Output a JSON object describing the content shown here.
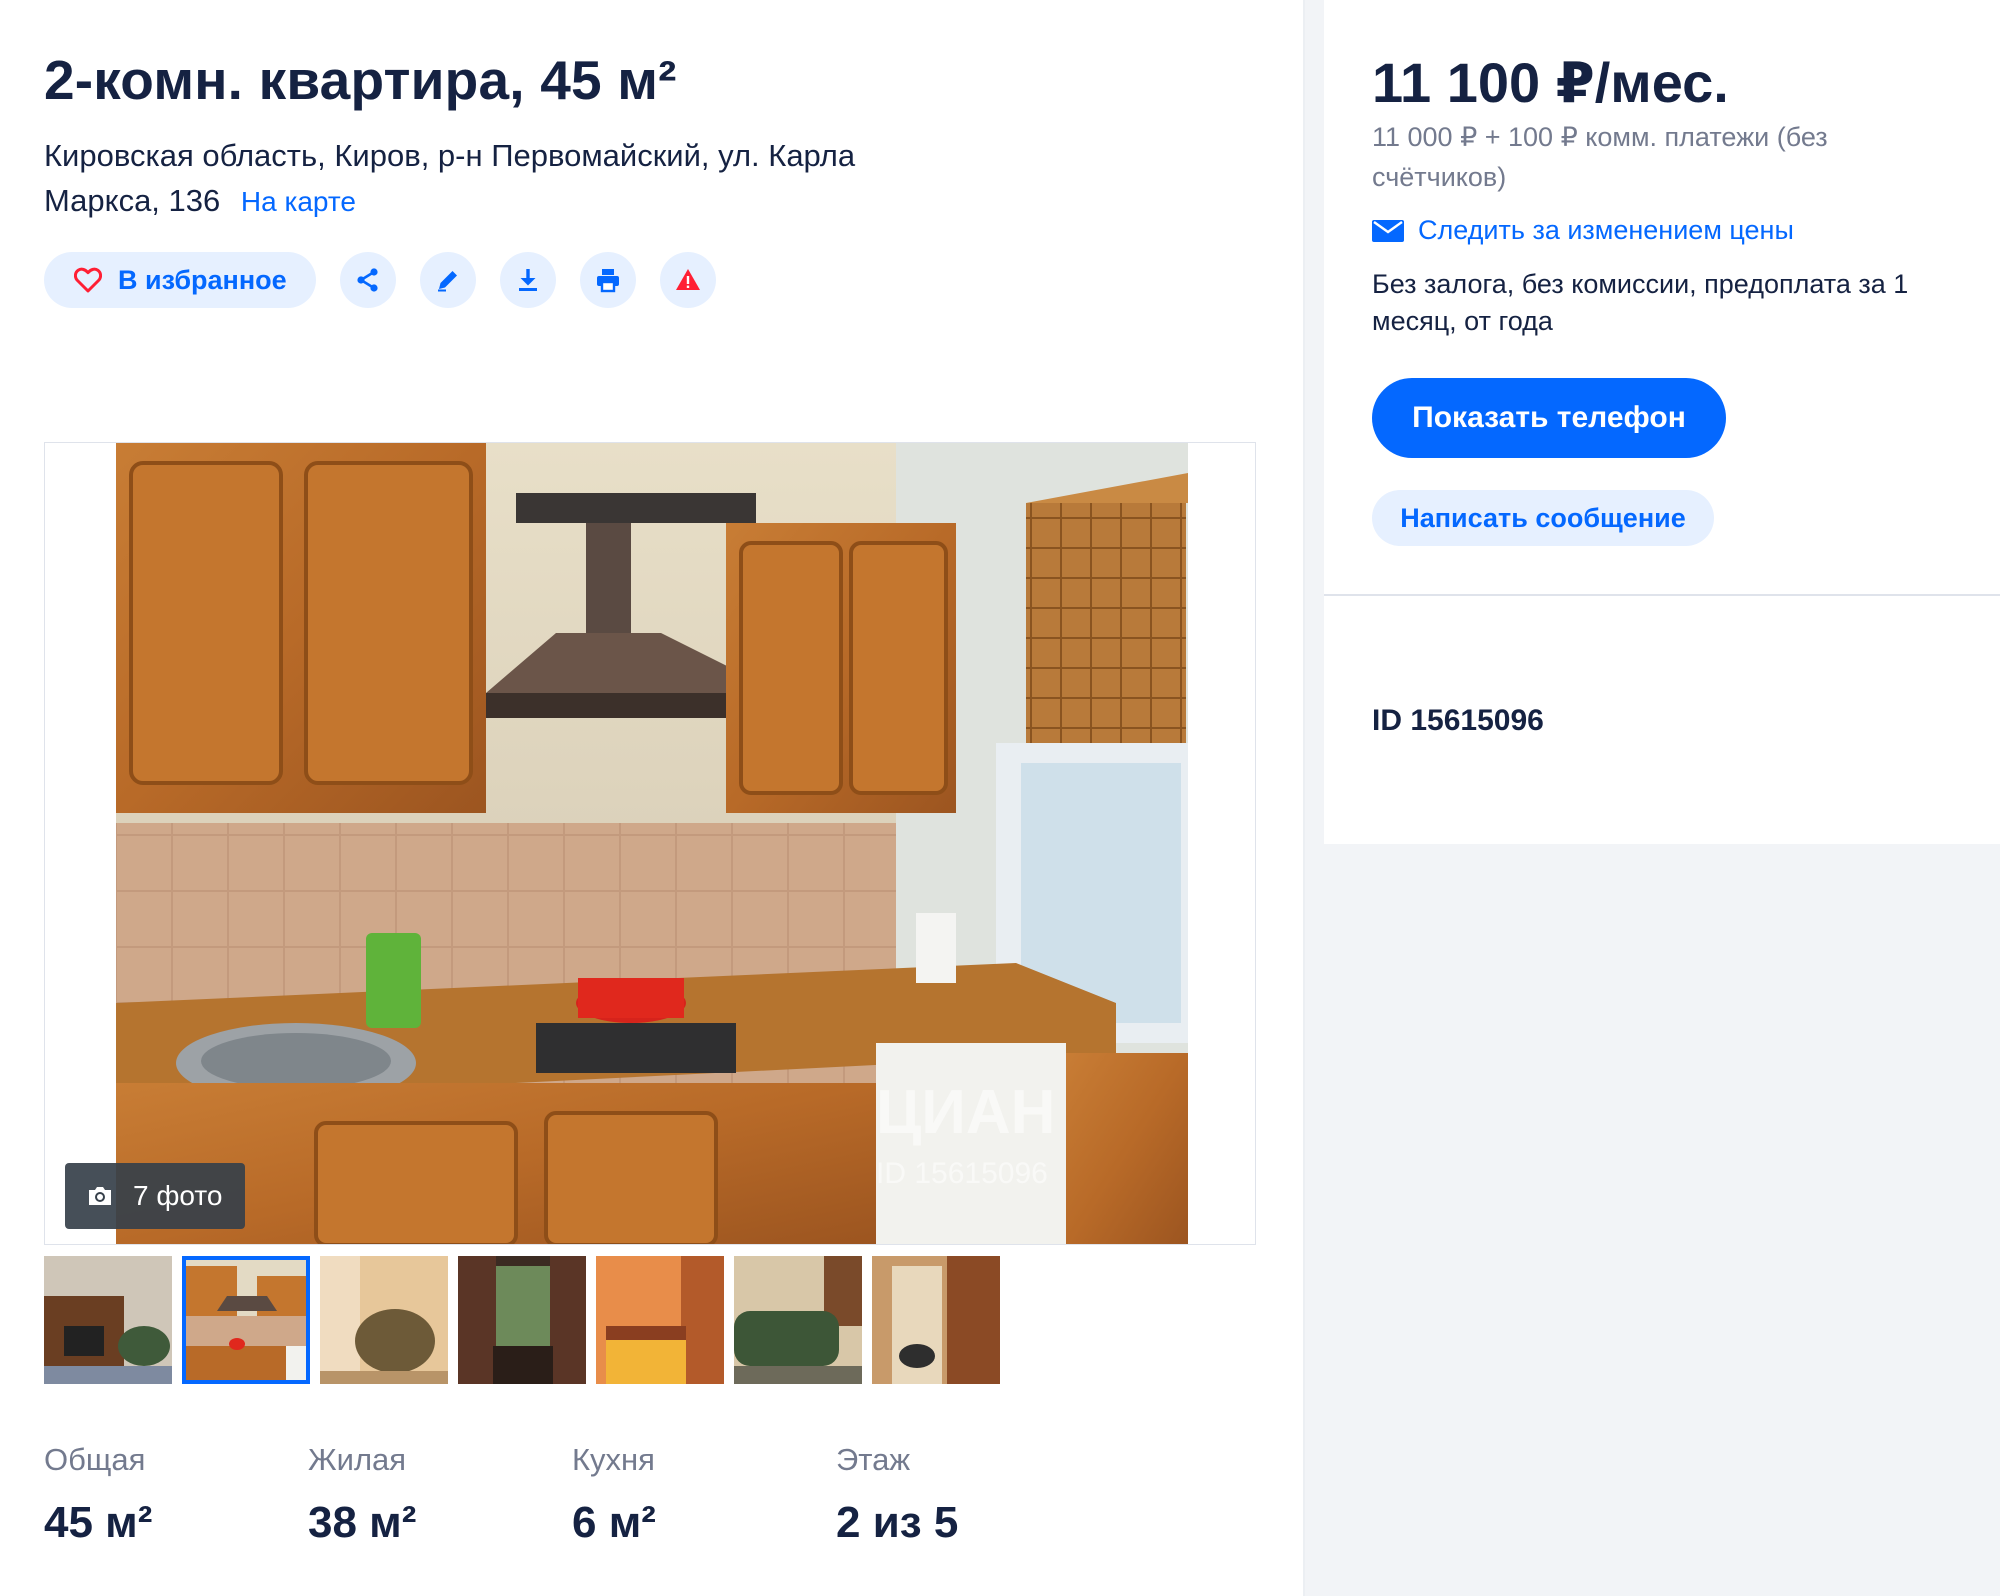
{
  "listing": {
    "title": "2-комн. квартира, 45 м²",
    "address": "Кировская область, Киров, р-н Первомайский, ул. Карла Маркса, 136",
    "map_link": "На карте"
  },
  "actions": {
    "favorite_label": "В избранное",
    "icons": [
      "share-icon",
      "edit-icon",
      "download-icon",
      "print-icon",
      "warning-icon"
    ]
  },
  "gallery": {
    "photo_count": "7 фото",
    "watermark": "ЦИАН",
    "watermark_id": "ID 15615096",
    "thumbnails": [
      "living-room",
      "kitchen",
      "armchair",
      "window-curtains",
      "bedroom",
      "sofa",
      "hallway"
    ],
    "active_thumbnail": 1
  },
  "params": [
    {
      "label": "Общая",
      "value": "45 м²"
    },
    {
      "label": "Жилая",
      "value": "38 м²"
    },
    {
      "label": "Кухня",
      "value": "6 м²"
    },
    {
      "label": "Этаж",
      "value": "2 из 5"
    }
  ],
  "offer": {
    "price": "11 100 ₽/мес.",
    "price_details": "11 000 ₽ + 100 ₽ комм. платежи (без счётчиков)",
    "track_price": "Следить за изменением цены",
    "terms": "Без залога, без комиссии, предоплата за 1 месяц, от года",
    "show_phone": "Показать телефон",
    "write_message": "Написать сообщение",
    "id_label": "ID 15615096"
  },
  "colors": {
    "accent": "#0468ff",
    "text": "#152242",
    "muted": "#737a8e",
    "button_light": "#e6f0ff",
    "danger": "#ff1f34"
  }
}
